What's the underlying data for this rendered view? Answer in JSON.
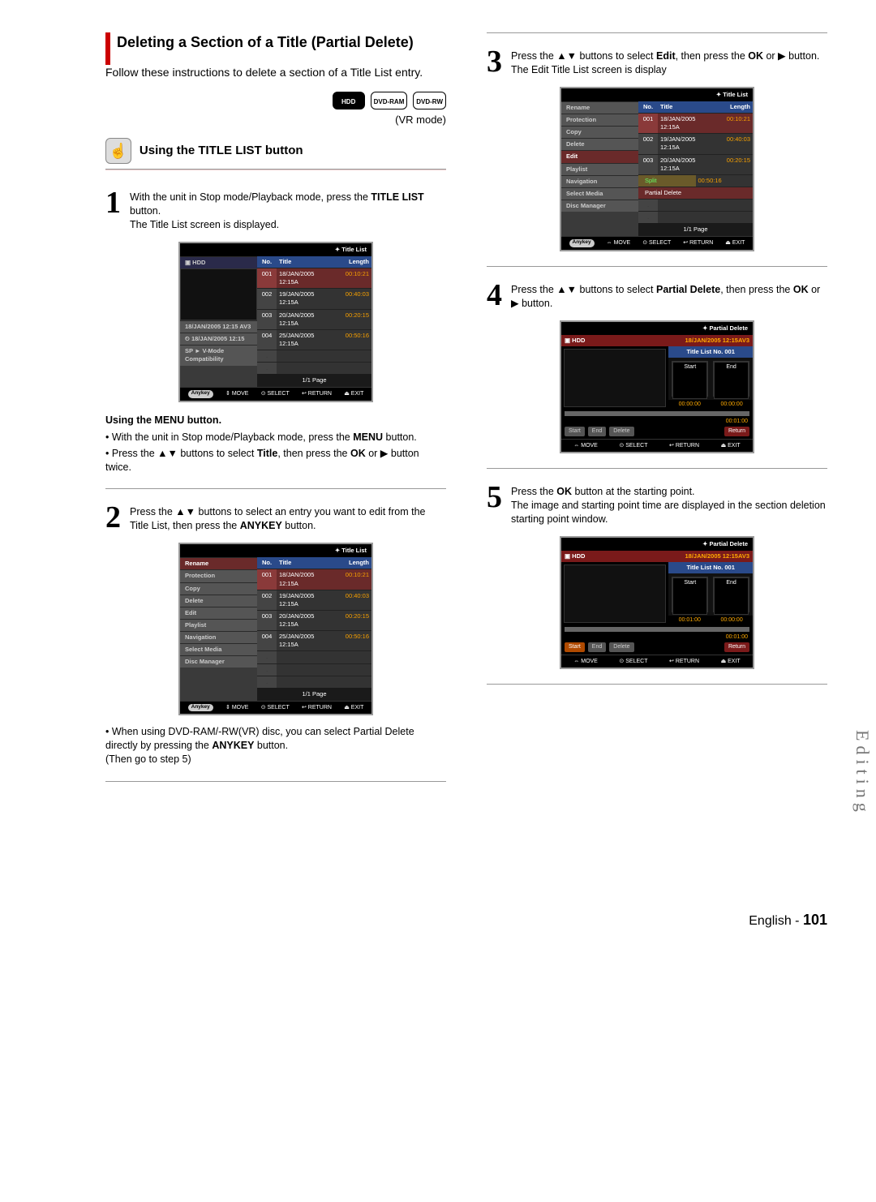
{
  "side_tab": "Editing",
  "left": {
    "title": "Deleting a Section of a Title (Partial Delete)",
    "intro": "Follow these instructions to delete a section of a Title List entry.",
    "media": {
      "hdd": "HDD",
      "ram": "DVD-RAM",
      "rw": "DVD-RW"
    },
    "vr_mode": "(VR mode)",
    "subhead": "Using the TITLE LIST button",
    "step1": {
      "num": "1",
      "line1": "With the unit in Stop mode/Playback mode, press the ",
      "bold": "TITLE LIST",
      "line1b": " button.",
      "line2": "The Title List screen is displayed."
    },
    "fig1": {
      "title": "Title List",
      "src": "HDD",
      "hdr_no": "No.",
      "hdr_title": "Title",
      "hdr_len": "Length",
      "rows": [
        {
          "no": "001",
          "t": "18/JAN/2005 12:15A",
          "len": "00:10:21",
          "hl": true
        },
        {
          "no": "002",
          "t": "19/JAN/2005 12:15A",
          "len": "00:40:03"
        },
        {
          "no": "003",
          "t": "20/JAN/2005 12:15A",
          "len": "00:20:15"
        },
        {
          "no": "004",
          "t": "25/JAN/2005 12:15A",
          "len": "00:50:16"
        }
      ],
      "left_items": [
        "18/JAN/2005 12:15 AV3",
        "18/JAN/2005 12:15",
        "SP ► V-Mode Compatibility"
      ],
      "pager": "1/1 Page",
      "foot_anykey": "Anykey",
      "foot_move": "MOVE",
      "foot_select": "SELECT",
      "foot_return": "RETURN",
      "foot_exit": "EXIT"
    },
    "menu_head": "Using the MENU button.",
    "menu_b1a": "With the unit in Stop mode/Playback mode, press the ",
    "menu_b1b": "MENU",
    "menu_b1c": " button.",
    "menu_b2a": "Press the ▲▼ buttons to select ",
    "menu_b2b": "Title",
    "menu_b2c": ", then press the ",
    "menu_b2d": "OK",
    "menu_b2e": " or ▶ button twice.",
    "step2": {
      "num": "2",
      "line1a": "Press the ▲▼ buttons to select an entry you want to edit from the Title List, then press the ",
      "line1b": "ANYKEY",
      "line1c": " button."
    },
    "fig2": {
      "title": "Title List",
      "left_items": [
        "Rename",
        "Protection",
        "Copy",
        "Delete",
        "Edit",
        "Playlist",
        "Navigation",
        "Select Media",
        "Disc Manager"
      ],
      "hdr_no": "No.",
      "hdr_title": "Title",
      "hdr_len": "Length",
      "rows": [
        {
          "no": "001",
          "t": "18/JAN/2005 12:15A",
          "len": "00:10:21",
          "hl": true
        },
        {
          "no": "002",
          "t": "19/JAN/2005 12:15A",
          "len": "00:40:03"
        },
        {
          "no": "003",
          "t": "20/JAN/2005 12:15A",
          "len": "00:20:15"
        },
        {
          "no": "004",
          "t": "25/JAN/2005 12:15A",
          "len": "00:50:16"
        }
      ],
      "pager": "1/1 Page",
      "foot_anykey": "Anykey",
      "foot_move": "MOVE",
      "foot_select": "SELECT",
      "foot_return": "RETURN",
      "foot_exit": "EXIT"
    },
    "note_a": "When using DVD-RAM/-RW(VR) disc, you can select Partial Delete directly by pressing the ",
    "note_b": "ANYKEY",
    "note_c": " button.",
    "note_d": "(Then go to step 5)"
  },
  "right": {
    "step3": {
      "num": "3",
      "a": "Press the ▲▼ buttons to select ",
      "b": "Edit",
      "c": ", then press the ",
      "d": "OK",
      "e": " or ▶ button.",
      "f": "The Edit Title List screen is display"
    },
    "fig3": {
      "title": "Title List",
      "left_items": [
        "Rename",
        "Protection",
        "Copy",
        "Delete",
        "Edit",
        "Playlist",
        "Navigation",
        "Select Media",
        "Disc Manager"
      ],
      "hdr_no": "No.",
      "hdr_title": "Title",
      "hdr_len": "Length",
      "rows": [
        {
          "no": "001",
          "t": "18/JAN/2005 12:15A",
          "len": "00:10:21",
          "hl": true
        },
        {
          "no": "002",
          "t": "19/JAN/2005 12:15A",
          "len": "00:40:03"
        },
        {
          "no": "003",
          "t": "20/JAN/2005 12:15A",
          "len": "00:20:15"
        },
        {
          "no": "",
          "t": "",
          "len": "00:50:16"
        }
      ],
      "sub_left": "Split",
      "sub_right": "Partial Delete",
      "pager": "1/1 Page",
      "foot_anykey": "Anykey",
      "foot_move": "MOVE",
      "foot_select": "SELECT",
      "foot_return": "RETURN",
      "foot_exit": "EXIT"
    },
    "step4": {
      "num": "4",
      "a": "Press the ▲▼ buttons to select ",
      "b": "Partial Delete",
      "c": ", then press the ",
      "d": "OK",
      "e": " or ▶ button."
    },
    "fig4": {
      "title": "Partial Delete",
      "src": "HDD",
      "name": "18/JAN/2005 12:15AV3",
      "sub": "Title List No. 001",
      "cap_start": "Start",
      "cap_end": "End",
      "t_start": "00:00:00",
      "t_end": "00:00:00",
      "total": "00:01:00",
      "btn_start": "Start",
      "btn_end": "End",
      "btn_del": "Delete",
      "btn_ret": "Return",
      "foot_move": "MOVE",
      "foot_select": "SELECT",
      "foot_return": "RETURN",
      "foot_exit": "EXIT"
    },
    "step5": {
      "num": "5",
      "a": "Press the ",
      "b": "OK",
      "c": " button at the starting point.",
      "d": "The image and starting point time are displayed in the section deletion starting point window."
    },
    "fig5": {
      "title": "Partial Delete",
      "src": "HDD",
      "name": "18/JAN/2005 12:15AV3",
      "sub": "Title List No. 001",
      "cap_start": "Start",
      "cap_end": "End",
      "t_start": "00:01:00",
      "t_end": "00:00:00",
      "total": "00:01:00",
      "btn_start": "Start",
      "btn_end": "End",
      "btn_del": "Delete",
      "btn_ret": "Return",
      "foot_move": "MOVE",
      "foot_select": "SELECT",
      "foot_return": "RETURN",
      "foot_exit": "EXIT"
    }
  },
  "footer": {
    "lang": "English -",
    "page": "101"
  }
}
